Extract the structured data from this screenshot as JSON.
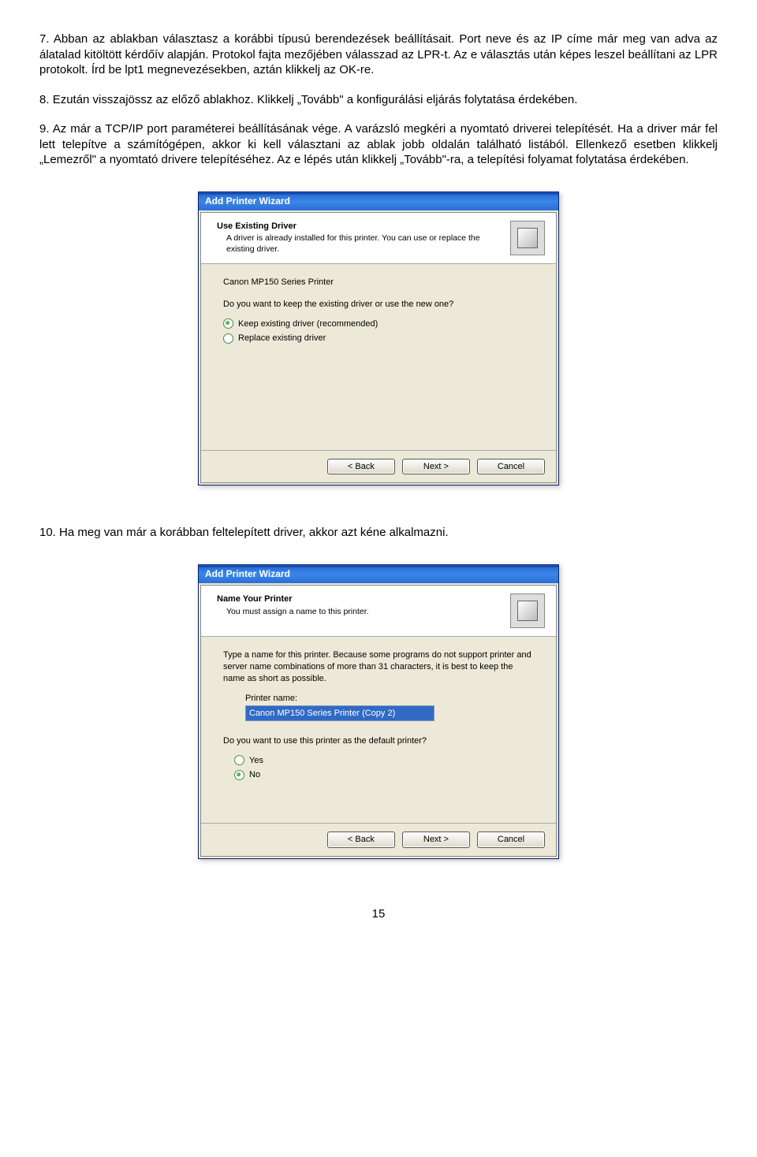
{
  "items": [
    {
      "num": "7.",
      "text": "Abban az ablakban választasz a korábbi típusú berendezések beállításait. Port neve és az IP címe már meg van adva az álatalad kitöltött kérdőív alapján. Protokol fajta mezőjében válasszad az LPR-t. Az e választás után képes leszel beállítani az LPR protokolt. Írd be lpt1 megnevezésekben, aztán klikkelj az OK-re."
    },
    {
      "num": "8.",
      "text": "Ezután visszajössz az előző ablakhoz. Klikkelj „Tovább\" a konfigurálási eljárás folytatása érdekében."
    },
    {
      "num": "9.",
      "text": "Az már a TCP/IP port paraméterei beállításának vége. A varázsló megkéri a nyomtató driverei telepítését. Ha a driver már fel lett telepítve a számítógépen, akkor ki kell választani az ablak jobb oldalán található listából. Ellenkező esetben klikkelj „Lemezről\" a nyomtató drivere telepítéséhez. Az e lépés után klikkelj „Tovább\"-ra, a telepítési folyamat folytatása érdekében."
    },
    {
      "num": "10.",
      "text": "Ha meg van már a korábban feltelepített driver, akkor azt kéne alkalmazni."
    }
  ],
  "dialog1": {
    "title": "Add Printer Wizard",
    "headerTitle": "Use Existing Driver",
    "headerSub": "A driver is already installed for this printer. You can use or replace the existing driver.",
    "device": "Canon MP150 Series Printer",
    "question": "Do you want to keep the existing driver or use the new one?",
    "opt1": "Keep existing driver (recommended)",
    "opt2": "Replace existing driver",
    "back": "< Back",
    "next": "Next >",
    "cancel": "Cancel"
  },
  "dialog2": {
    "title": "Add Printer Wizard",
    "headerTitle": "Name Your Printer",
    "headerSub": "You must assign a name to this printer.",
    "instr": "Type a name for this printer. Because some programs do not support printer and server name combinations of more than 31 characters, it is best to keep the name as short as possible.",
    "nameLabel": "Printer name:",
    "nameValue": "Canon MP150 Series Printer (Copy 2)",
    "question": "Do you want to use this printer as the default printer?",
    "yes": "Yes",
    "no": "No",
    "back": "< Back",
    "next": "Next >",
    "cancel": "Cancel"
  },
  "pageNumber": "15"
}
